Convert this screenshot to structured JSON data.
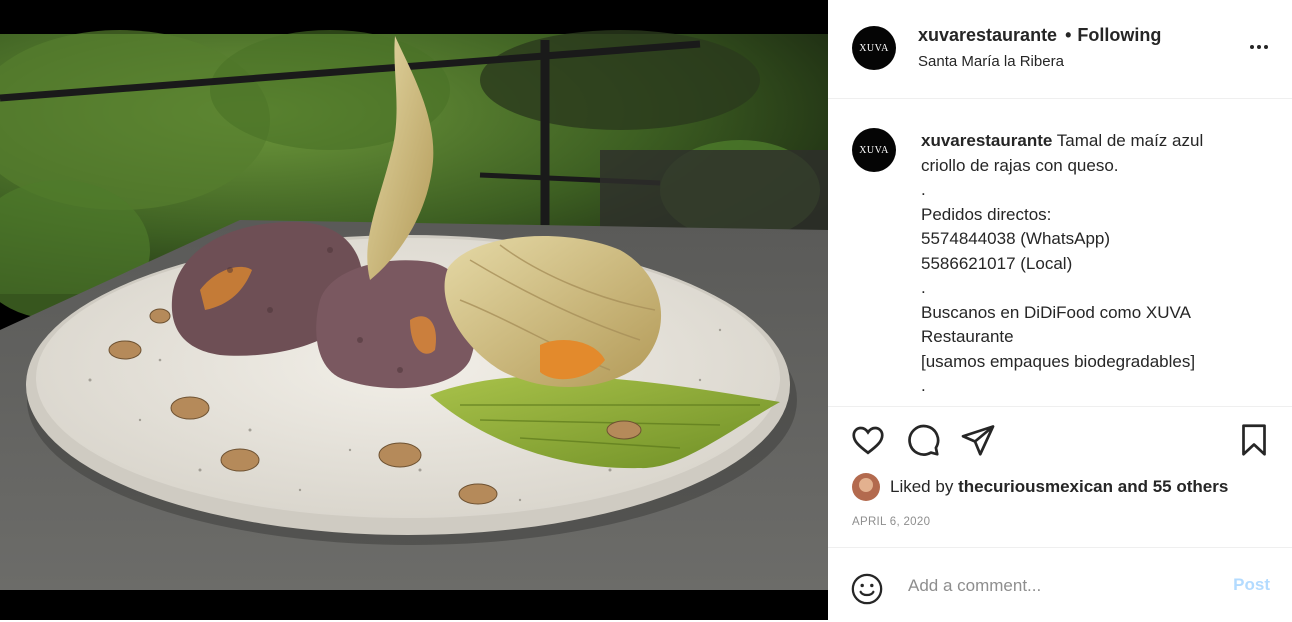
{
  "post": {
    "account": {
      "username": "xuvarestaurante",
      "avatar_text": "XUVA",
      "follow_status": "Following",
      "location": "Santa María la Ribera"
    },
    "caption": {
      "username": "xuvarestaurante",
      "lines": [
        "Tamal de maíz azul",
        "criollo de rajas con queso.",
        ".",
        "Pedidos directos:",
        "5574844038 (WhatsApp)",
        "5586621017 (Local)",
        ".",
        "Buscanos en DiDiFood como XUVA",
        "Restaurante",
        "[usamos empaques biodegradables]",
        "."
      ]
    },
    "likes": {
      "prefix": "Liked by",
      "user": "thecuriousmexican",
      "suffix": "and 55 others"
    },
    "date": "APRIL 6, 2020",
    "comment": {
      "placeholder": "Add a comment...",
      "post_label": "Post"
    },
    "icons": {
      "like": "heart-icon",
      "comment": "comment-bubble-icon",
      "share": "paper-plane-icon",
      "save": "bookmark-icon",
      "more": "ellipsis-icon",
      "emoji": "smiley-icon"
    },
    "colors": {
      "post_button": "#b3dbff",
      "muted_text": "#8e8e8e"
    }
  }
}
